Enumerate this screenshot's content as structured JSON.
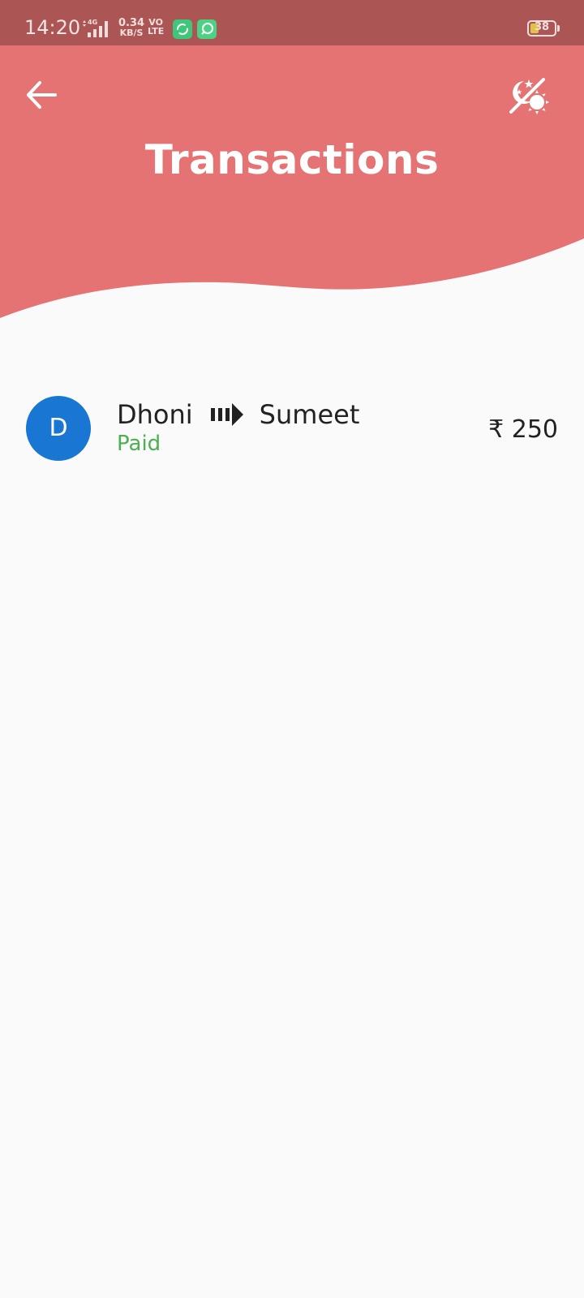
{
  "status_bar": {
    "time": "14:20",
    "network_type": "4G",
    "speed_value": "0.34",
    "speed_unit": "KB/S",
    "volte_top": "VO",
    "volte_bottom": "LTE",
    "battery_level": "38",
    "icons": [
      "signal-icon",
      "sync-app-icon",
      "chat-app-icon",
      "battery-icon"
    ]
  },
  "header": {
    "title": "Transactions",
    "back_icon": "arrow-left-icon",
    "theme_icon": "day-night-toggle-icon",
    "color": "#e67373"
  },
  "transactions": [
    {
      "avatar_letter": "D",
      "from": "Dhoni",
      "to": "Sumeet",
      "status": "Paid",
      "amount": "₹ 250",
      "arrow_icon": "transfer-arrow-icon",
      "avatar_color": "#1976d2",
      "status_color": "#4caf50"
    }
  ]
}
